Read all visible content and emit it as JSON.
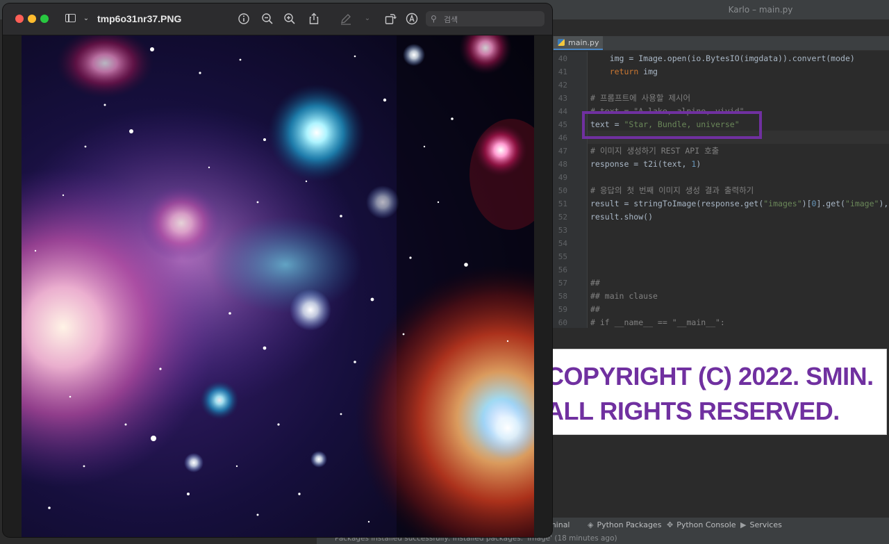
{
  "ide": {
    "window_title": "Karlo – main.py",
    "tab_label": "main.py",
    "code_lines": [
      {
        "n": "40",
        "parts": [
          {
            "t": "    img = Image.open(io.BytesIO(imgdata)).convert(mode)",
            "c": ""
          }
        ]
      },
      {
        "n": "41",
        "parts": [
          {
            "t": "    ",
            "c": ""
          },
          {
            "t": "return",
            "c": "kw"
          },
          {
            "t": " img",
            "c": ""
          }
        ]
      },
      {
        "n": "42",
        "parts": []
      },
      {
        "n": "43",
        "parts": [
          {
            "t": "# 프롬프트에 사용할 제시어",
            "c": "comment"
          }
        ]
      },
      {
        "n": "44",
        "parts": [
          {
            "t": "# text = \"A lake, alpine, vivid\"",
            "c": "comment"
          }
        ]
      },
      {
        "n": "45",
        "parts": [
          {
            "t": "text = ",
            "c": ""
          },
          {
            "t": "\"Star, Bundle, universe\"",
            "c": "str"
          }
        ]
      },
      {
        "n": "46",
        "parts": []
      },
      {
        "n": "47",
        "parts": [
          {
            "t": "# 이미지 생성하기 REST API 호출",
            "c": "comment"
          }
        ]
      },
      {
        "n": "48",
        "parts": [
          {
            "t": "response = t2i(text, ",
            "c": ""
          },
          {
            "t": "1",
            "c": "num"
          },
          {
            "t": ")",
            "c": ""
          }
        ]
      },
      {
        "n": "49",
        "parts": []
      },
      {
        "n": "50",
        "parts": [
          {
            "t": "# 응답의 첫 번째 이미지 생성 결과 출력하기",
            "c": "comment"
          }
        ]
      },
      {
        "n": "51",
        "parts": [
          {
            "t": "result = stringToImage(response.get(",
            "c": ""
          },
          {
            "t": "\"images\"",
            "c": "str"
          },
          {
            "t": ")[",
            "c": ""
          },
          {
            "t": "0",
            "c": "num"
          },
          {
            "t": "].get(",
            "c": ""
          },
          {
            "t": "\"image\"",
            "c": "str"
          },
          {
            "t": "),",
            "c": ""
          }
        ]
      },
      {
        "n": "52",
        "parts": [
          {
            "t": "result.show()",
            "c": ""
          }
        ]
      },
      {
        "n": "53",
        "parts": []
      },
      {
        "n": "54",
        "parts": []
      },
      {
        "n": "55",
        "parts": []
      },
      {
        "n": "56",
        "parts": []
      },
      {
        "n": "57",
        "parts": [
          {
            "t": "##",
            "c": "comment"
          }
        ]
      },
      {
        "n": "58",
        "parts": [
          {
            "t": "## main clause",
            "c": "comment"
          }
        ]
      },
      {
        "n": "59",
        "parts": [
          {
            "t": "##",
            "c": "comment"
          }
        ]
      },
      {
        "n": "60",
        "parts": [
          {
            "t": "# if __name__ == \"__main__\":",
            "c": "comment"
          }
        ]
      }
    ],
    "bottom_toolbar": {
      "terminal": "Terminal",
      "python_packages": "Python Packages",
      "python_console": "Python Console",
      "services": "Services"
    },
    "status_message": "Packages installed successfully: Installed packages: 'image' (18 minutes ago)"
  },
  "preview": {
    "filename": "tmp6o31nr37.PNG",
    "search_placeholder": "검색",
    "icons": [
      "sidebar-icon",
      "chevron-down-icon",
      "info-icon",
      "zoom-out-icon",
      "zoom-in-icon",
      "share-icon",
      "pen-icon",
      "rotate-icon",
      "markup-icon",
      "search-icon"
    ]
  },
  "copyright": {
    "line1": "COPYRIGHT (C) 2022. SMIN.",
    "line2": "ALL RIGHTS RESERVED."
  },
  "colors": {
    "highlight_box": "#7030a0",
    "copyright_text": "#7030a0",
    "traffic_close": "#fe5f57",
    "traffic_min": "#febc2e",
    "traffic_max": "#28c840"
  }
}
